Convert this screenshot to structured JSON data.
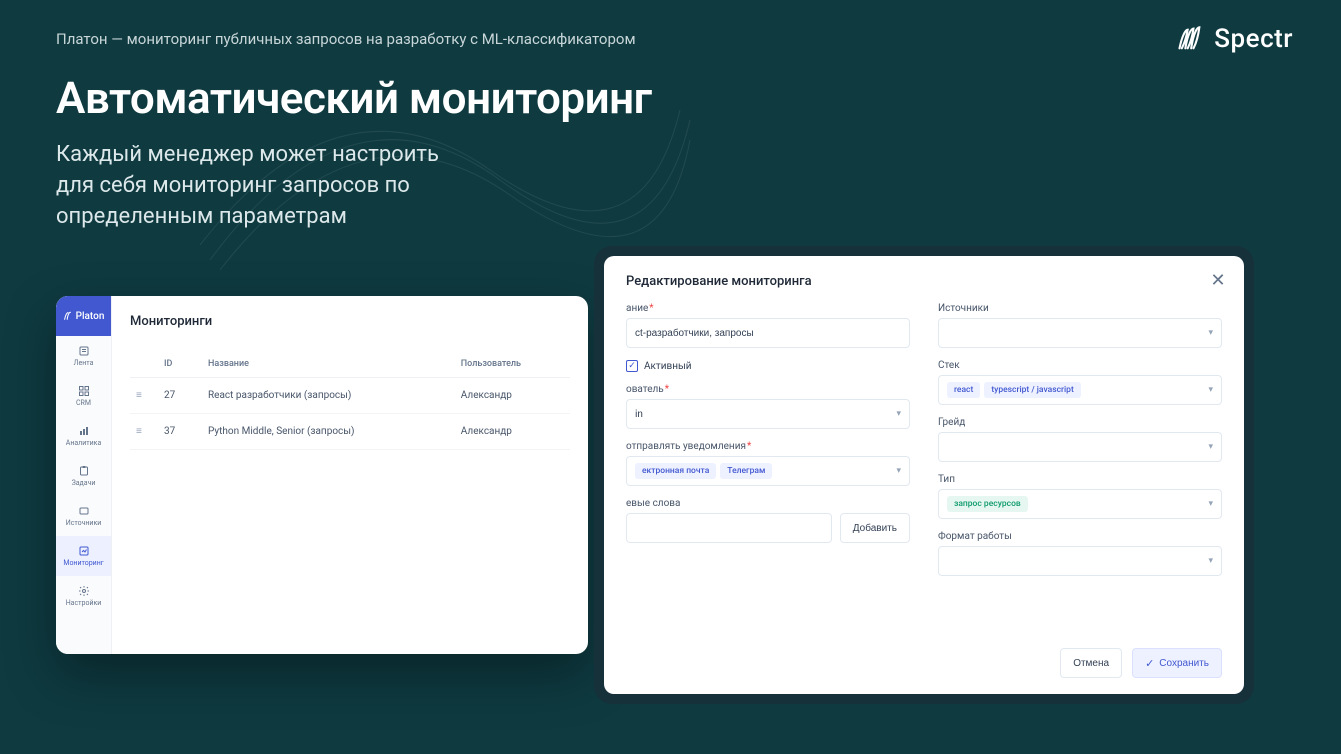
{
  "tagline": "Платон — мониторинг публичных запросов на разработку с ML-классификатором",
  "brand": {
    "name": "Spectr"
  },
  "title": "Автоматический мониторинг",
  "subtitle": "Каждый менеджер может настроить для себя мониторинг запросов по определенным параметрам",
  "sidebar": {
    "brand": "Platon",
    "items": [
      {
        "label": "Лента"
      },
      {
        "label": "CRM"
      },
      {
        "label": "Аналитика"
      },
      {
        "label": "Задачи"
      },
      {
        "label": "Источники"
      },
      {
        "label": "Мониторинг",
        "active": true
      },
      {
        "label": "Настройки"
      }
    ]
  },
  "panel": {
    "title": "Мониторинги",
    "cols": {
      "id": "ID",
      "name": "Название",
      "user": "Пользователь"
    },
    "rows": [
      {
        "id": "27",
        "name": "React разработчики (запросы)",
        "user": "Александр"
      },
      {
        "id": "37",
        "name": "Python Middle, Senior (запросы)",
        "user": "Александр"
      }
    ]
  },
  "modal": {
    "title": "Редактирование мониторинга",
    "name_label": "ание",
    "name_value": "ct-разработчики, запросы",
    "active_label": "Активный",
    "user_label": "ователь",
    "user_value": "in",
    "notify_label": "отправлять уведомления",
    "notify_chips": [
      "ектронная почта",
      "Телеграм"
    ],
    "keywords_label": "евые слова",
    "add_btn": "Добавить",
    "sources_label": "Источники",
    "stack_label": "Стек",
    "stack_chips": [
      "react",
      "typescript / javascript"
    ],
    "grade_label": "Грейд",
    "type_label": "Тип",
    "type_chips": [
      "запрос ресурсов"
    ],
    "format_label": "Формат работы",
    "cancel": "Отмена",
    "save": "Сохранить"
  }
}
